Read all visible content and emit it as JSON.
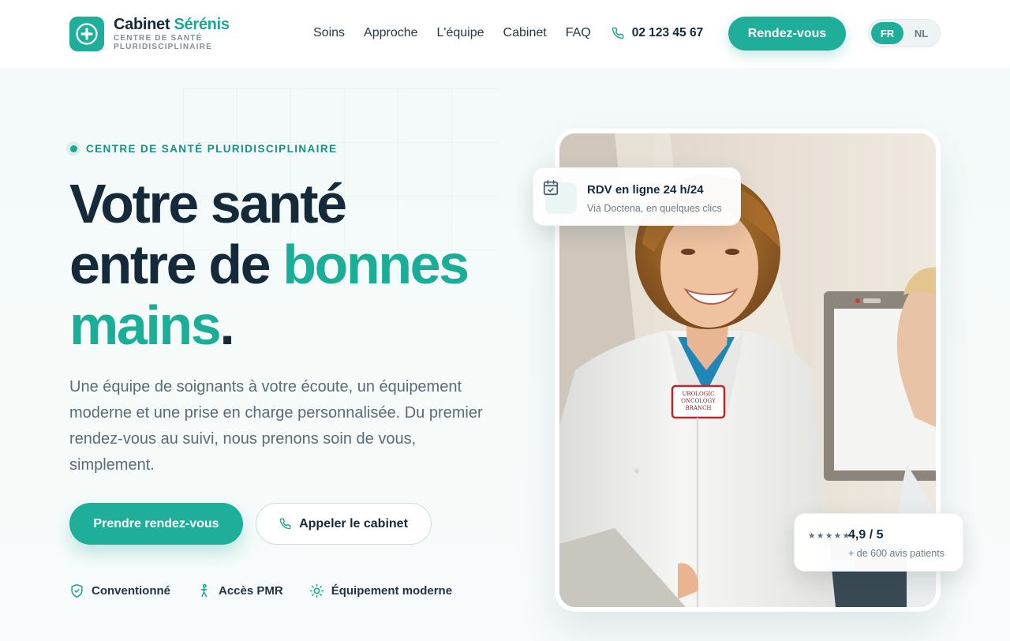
{
  "header": {
    "brand": {
      "name": "Cabinet",
      "accent": "Sérénis",
      "subtitle": "CENTRE DE SANTÉ PLURIDISCIPLINAIRE"
    },
    "nav": [
      "Soins",
      "Approche",
      "L'équipe",
      "Cabinet",
      "FAQ"
    ],
    "phone": "02 123 45 67",
    "cta": "Rendez-vous",
    "languages": [
      "FR",
      "NL"
    ],
    "active_language": "FR"
  },
  "hero": {
    "eyebrow": "CENTRE DE SANTÉ PLURIDISCIPLINAIRE",
    "headline": {
      "part1": "Votre santé",
      "part2": "entre de",
      "accent1": "bonnes",
      "accent2": "mains",
      "end": "."
    },
    "lead": "Une équipe de soignants à votre écoute, un équipement moderne et une prise en charge personnalisée. Du premier rendez-vous au suivi, nous prenons soin de vous, simplement.",
    "primary_cta": "Prendre rendez-vous",
    "secondary_cta": "Appeler le cabinet",
    "features": [
      "Conventionné",
      "Accès PMR",
      "Équipement moderne"
    ]
  },
  "cards": {
    "rdv": {
      "title": "RDV en ligne 24 h/24",
      "subtitle": "Via Doctena, en quelques clics"
    },
    "rating": {
      "stars": "★★★★★",
      "score": "4,9 / 5",
      "subtitle": "+ de 600 avis patients"
    }
  },
  "photo": {
    "badge_line1": "UROLOGIC",
    "badge_line2": "ONCOLOGY",
    "badge_line3": "BRANCH"
  },
  "colors": {
    "accent": "#1fae9a",
    "dark": "#14293a",
    "muted": "#5a6a76"
  }
}
